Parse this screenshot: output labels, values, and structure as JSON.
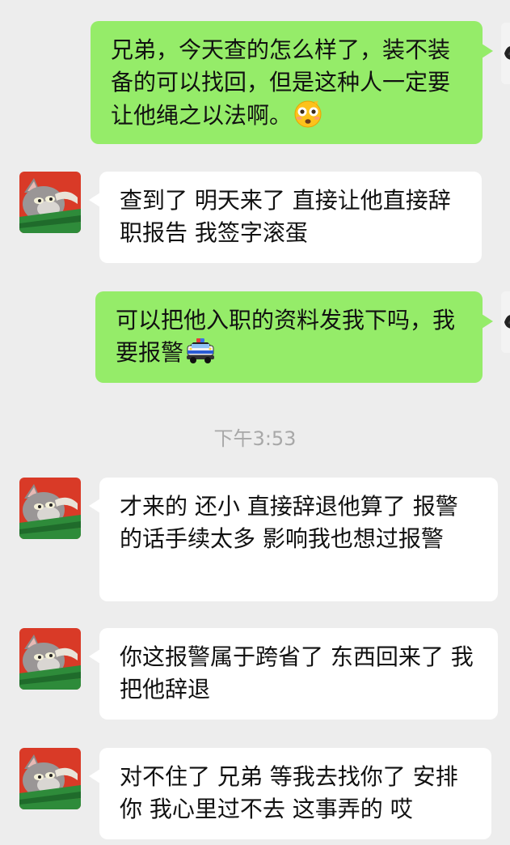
{
  "messages": [
    {
      "side": "right",
      "text": "兄弟，今天查的怎么样了，装不装备的可以找回，但是这种人一定要让他绳之以法啊。",
      "emoji": "flushed-face-emoji"
    },
    {
      "side": "left",
      "text": "查到了 明天来了 直接让他直接辞职报告 我签字滚蛋"
    },
    {
      "side": "right",
      "text": "可以把他入职的资料发我下吗，我要报警",
      "emoji": "police-car-emoji"
    },
    {
      "side": "left",
      "text": "才来的 还小 直接辞退他算了 报警的话手续太多 影响我也想过报警"
    },
    {
      "side": "left",
      "text": "你这报警属于跨省了 东西回来了 我把他辞退"
    },
    {
      "side": "left",
      "text": "对不住了 兄弟 等我去找你了 安排你 我心里过不去 这事弄的 哎"
    }
  ],
  "timestamp": "下午3:53",
  "colors": {
    "background": "#ededed",
    "sent_bubble": "#95ec69",
    "received_bubble": "#ffffff",
    "timestamp_text": "#a8a8a8",
    "avatar_background": "#d93a27"
  },
  "avatar": {
    "left_icon": "cartoon-cat-avatar-icon",
    "right_icon": "own-avatar-icon"
  }
}
